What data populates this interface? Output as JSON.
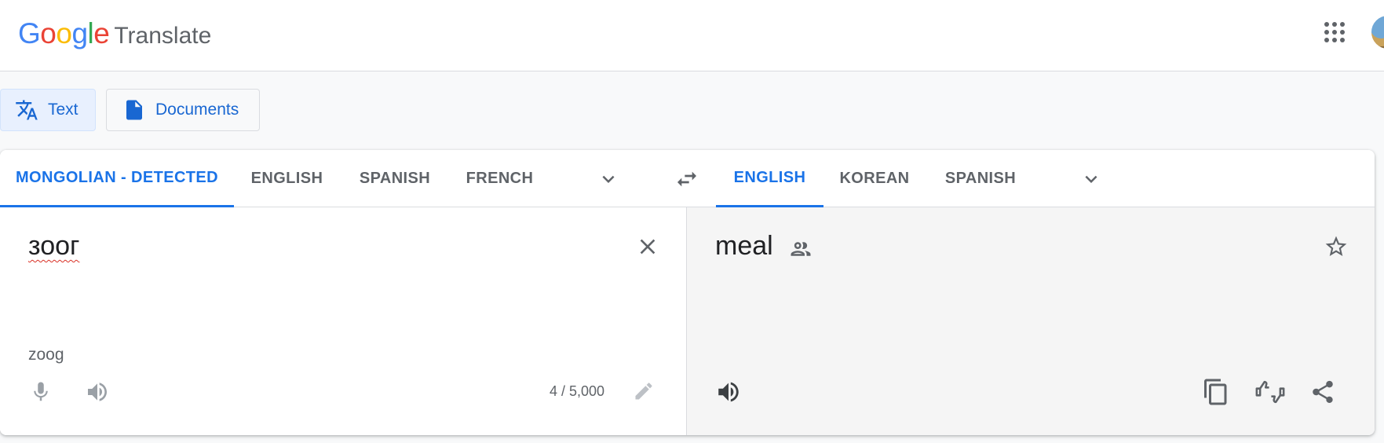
{
  "header": {
    "logo_letters": [
      {
        "char": "G",
        "color": "#4285F4"
      },
      {
        "char": "o",
        "color": "#EA4335"
      },
      {
        "char": "o",
        "color": "#FBBC05"
      },
      {
        "char": "g",
        "color": "#4285F4"
      },
      {
        "char": "l",
        "color": "#34A853"
      },
      {
        "char": "e",
        "color": "#EA4335"
      }
    ],
    "logo_word": "Google",
    "product_name": "Translate",
    "apps_icon": "apps-grid-icon",
    "avatar_icon": "account-avatar"
  },
  "modes": [
    {
      "label": "Text",
      "icon": "translate-icon",
      "active": true
    },
    {
      "label": "Documents",
      "icon": "document-icon",
      "active": false
    }
  ],
  "source_languages": [
    {
      "label": "MONGOLIAN - DETECTED",
      "active": true
    },
    {
      "label": "ENGLISH",
      "active": false
    },
    {
      "label": "SPANISH",
      "active": false
    },
    {
      "label": "FRENCH",
      "active": false
    }
  ],
  "target_languages": [
    {
      "label": "ENGLISH",
      "active": true
    },
    {
      "label": "KOREAN",
      "active": false
    },
    {
      "label": "SPANISH",
      "active": false
    }
  ],
  "source": {
    "text": "зоог",
    "transliteration": "zoog",
    "char_count": "4 / 5,000"
  },
  "target": {
    "text": "meal"
  },
  "colors": {
    "accent": "#1a73e8",
    "muted": "#5f6368",
    "target_bg": "#f5f5f5",
    "spell_error": "#d93025"
  }
}
